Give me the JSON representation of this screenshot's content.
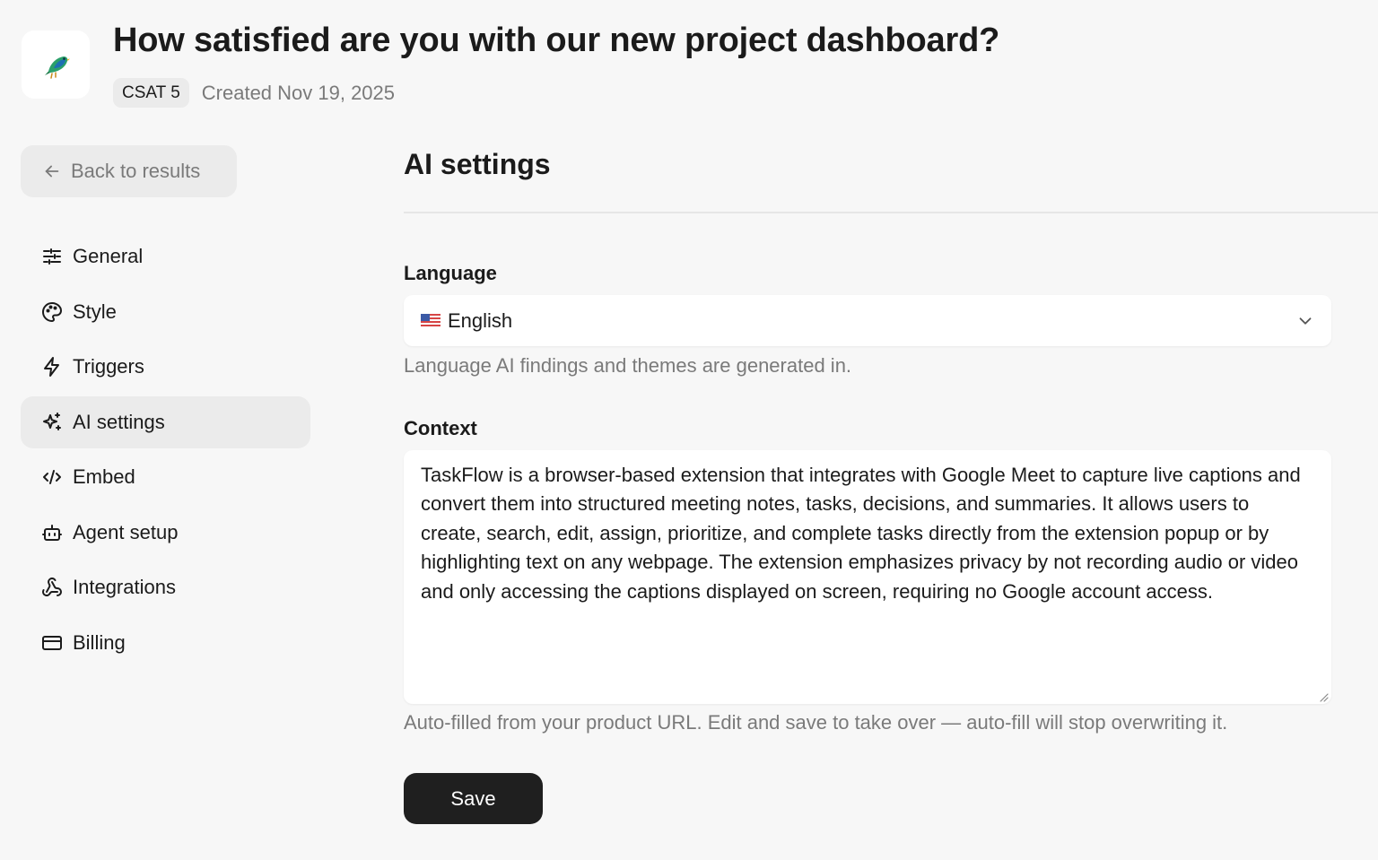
{
  "header": {
    "title": "How satisfied are you with our new project dashboard?",
    "badge": "CSAT 5",
    "created": "Created Nov 19, 2025",
    "logo_icon": "bird-logo-icon"
  },
  "sidebar": {
    "back_label": "Back to results",
    "items": [
      {
        "label": "General",
        "icon": "sliders-icon",
        "active": false
      },
      {
        "label": "Style",
        "icon": "palette-icon",
        "active": false
      },
      {
        "label": "Triggers",
        "icon": "lightning-icon",
        "active": false
      },
      {
        "label": "AI settings",
        "icon": "sparkles-icon",
        "active": true
      },
      {
        "label": "Embed",
        "icon": "code-icon",
        "active": false
      },
      {
        "label": "Agent setup",
        "icon": "robot-icon",
        "active": false
      },
      {
        "label": "Integrations",
        "icon": "webhook-icon",
        "active": false
      },
      {
        "label": "Billing",
        "icon": "credit-card-icon",
        "active": false
      }
    ]
  },
  "main": {
    "title": "AI settings",
    "language": {
      "label": "Language",
      "value": "English",
      "help": "Language AI findings and themes are generated in."
    },
    "context": {
      "label": "Context",
      "value": "TaskFlow is a browser-based extension that integrates with Google Meet to capture live captions and convert them into structured meeting notes, tasks, decisions, and summaries. It allows users to create, search, edit, assign, prioritize, and complete tasks directly from the extension popup or by highlighting text on any webpage. The extension emphasizes privacy by not recording audio or video and only accessing the captions displayed on screen, requiring no Google account access.",
      "help": "Auto-filled from your product URL. Edit and save to take over — auto-fill will stop overwriting it."
    },
    "save_label": "Save"
  },
  "colors": {
    "background": "#f7f7f7",
    "active_nav": "#ebebeb",
    "save_button": "#1f1f1f",
    "muted_text": "#7a7a7a"
  }
}
